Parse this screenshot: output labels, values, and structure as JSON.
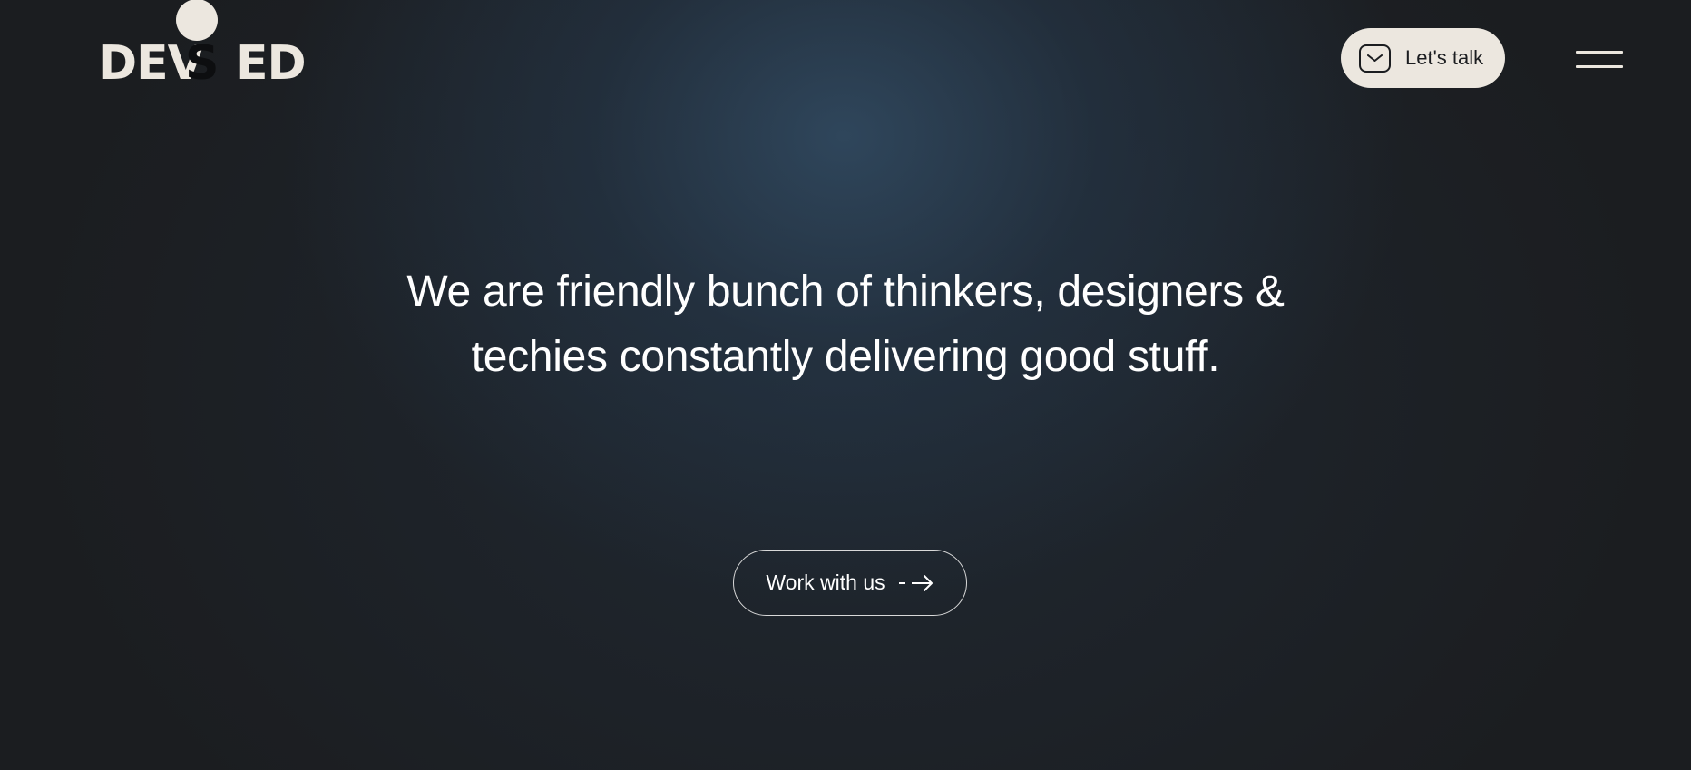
{
  "header": {
    "logo": {
      "text": "DEVSED",
      "text_part1": "DEV",
      "letter_s": "S",
      "text_part2": "ED"
    },
    "lets_talk": {
      "label": "Let's talk",
      "icon": "mail-icon"
    },
    "menu": {
      "icon": "hamburger-menu-icon"
    }
  },
  "hero": {
    "title": "We are friendly bunch of thinkers, designers & techies constantly delivering good stuff.",
    "cta": {
      "label": "Work with us",
      "icon": "arrow-right-icon"
    }
  },
  "colors": {
    "background": "#1b1d20",
    "glow": "#324c64",
    "accent_cream": "#ece7df",
    "text": "#ffffff"
  }
}
